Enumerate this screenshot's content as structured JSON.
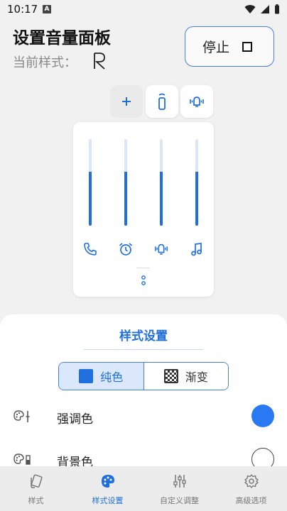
{
  "status_bar": {
    "time": "10:17",
    "notification_badge": "A"
  },
  "header": {
    "title": "设置音量面板",
    "current_style_label": "当前样式：",
    "stop_button_label": "停止"
  },
  "volume_panel": {
    "sliders": [
      {
        "icon": "phone-icon",
        "level": 0.62
      },
      {
        "icon": "alarm-icon",
        "level": 0.62
      },
      {
        "icon": "vibrate-icon",
        "level": 0.62
      },
      {
        "icon": "music-icon",
        "level": 0.62
      }
    ]
  },
  "style_settings": {
    "title": "样式设置",
    "tabs": {
      "solid": "纯色",
      "gradient": "渐变"
    },
    "selected_tab": "solid",
    "rows": [
      {
        "label": "强调色",
        "color": "#2979f2"
      },
      {
        "label": "背景色",
        "color": "#ffffff"
      }
    ]
  },
  "bottom_nav": {
    "items": [
      {
        "label": "样式",
        "icon": "style-icon"
      },
      {
        "label": "样式设置",
        "icon": "palette-icon"
      },
      {
        "label": "自定义调整",
        "icon": "tune-icon"
      },
      {
        "label": "高级选项",
        "icon": "gear-icon"
      }
    ],
    "active_index": 1
  },
  "colors": {
    "accent": "#1f6fde",
    "slider_track": "#dbe7f9",
    "nav_bg": "#ececec"
  }
}
